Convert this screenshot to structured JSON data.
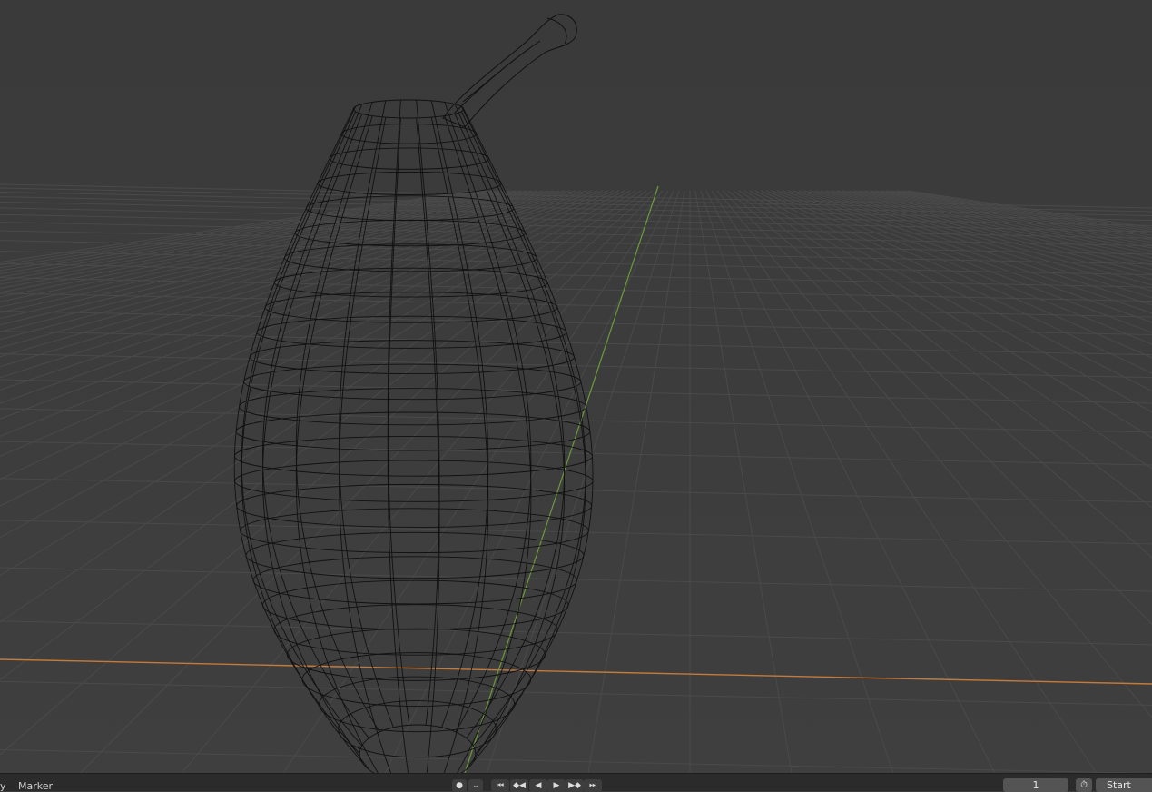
{
  "timeline": {
    "menu_view_partial": "y",
    "menu_marker": "Marker",
    "current_frame": "1",
    "start_label": "Start"
  },
  "icons": {
    "keying": "●",
    "keying_dropdown": "⌄",
    "jump_start": "⏮",
    "prev_keyframe": "◆◀",
    "play_reverse": "◀",
    "play": "▶",
    "next_keyframe": "▶◆",
    "jump_end": "⏭",
    "stopwatch": "⏱"
  },
  "colors": {
    "viewport_bg": "#3d3d3d",
    "grid": "#4a4a4a",
    "x_axis": "#c47a3a",
    "y_axis": "#6d9a3a",
    "wire": "#111111"
  }
}
